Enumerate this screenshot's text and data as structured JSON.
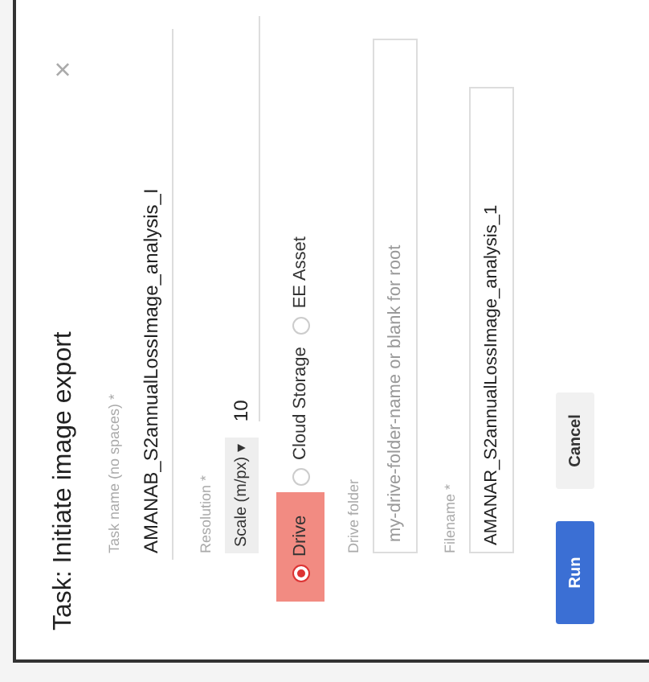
{
  "dialog": {
    "title": "Task: Initiate image export",
    "close": "×",
    "task_name": {
      "label": "Task name (no spaces) *",
      "value": "AMANAB_S2annualLossImage_analysis_I"
    },
    "resolution": {
      "label": "Resolution *",
      "unit": "Scale (m/px)",
      "caret": "▾",
      "value": "10"
    },
    "destinations": [
      {
        "label": "Drive",
        "selected": true,
        "highlighted": true
      },
      {
        "label": "Cloud Storage",
        "selected": false,
        "highlighted": false
      },
      {
        "label": "EE Asset",
        "selected": false,
        "highlighted": false
      }
    ],
    "drive_folder": {
      "label": "Drive folder",
      "placeholder": "my-drive-folder-name or blank for root"
    },
    "filename": {
      "label": "Filename *",
      "value": "AMANAR_S2annualLossImage_analysis_1"
    },
    "buttons": [
      {
        "label": "Run",
        "kind": "primary"
      },
      {
        "label": "Cancel",
        "kind": "secondary"
      }
    ]
  }
}
